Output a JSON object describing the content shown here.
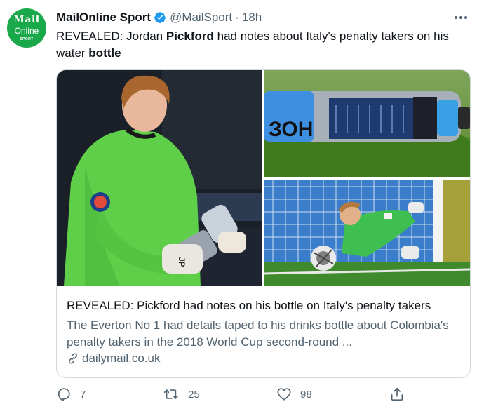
{
  "account": {
    "avatar_line1": "Mail",
    "avatar_line2": "Online",
    "avatar_line3": "SPORT",
    "display_name": "MailOnline Sport",
    "handle": "@MailSport",
    "separator": "·",
    "time": "18h",
    "verified_color": "#1d9bf0"
  },
  "tweet": {
    "text_1": "REVEALED: Jordan ",
    "bold_1": "Pickford",
    "text_2": " had notes about Italy's penalty takers on his water ",
    "bold_2": "bottle"
  },
  "card": {
    "images": [
      "goalkeeper-holding-bottle",
      "water-bottle-on-grass",
      "goalkeeper-diving-save"
    ],
    "title": "REVEALED: Pickford had notes on his bottle on Italy's penalty takers",
    "description": "The Everton No 1 had details taped to his drinks bottle about Colombia's penalty takers in the 2018 World Cup second-round ...",
    "domain": "dailymail.co.uk",
    "jersey_text": "JP"
  },
  "actions": {
    "replies": "7",
    "retweets": "25",
    "likes": "98"
  }
}
